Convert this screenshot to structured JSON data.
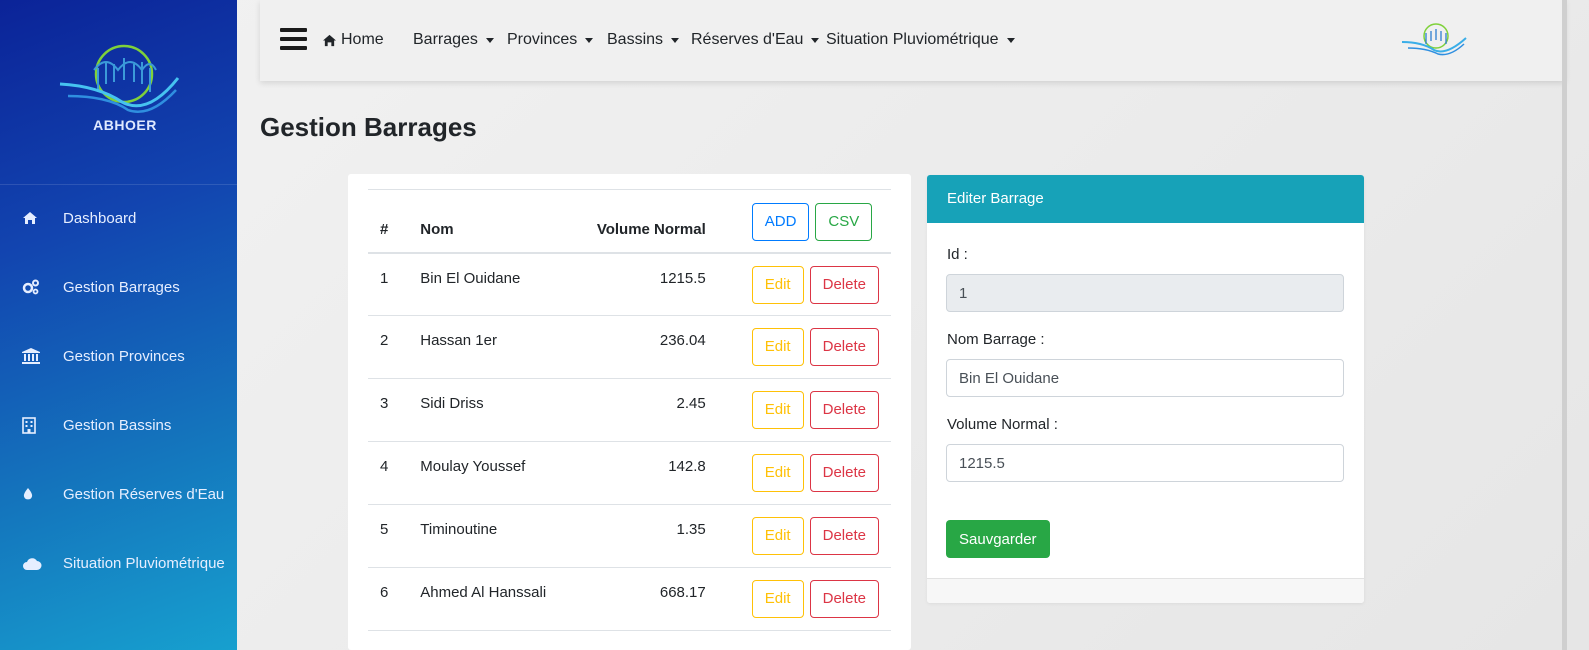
{
  "brand": {
    "name": "ABHOER"
  },
  "sidebar": {
    "items": [
      {
        "label": "Dashboard",
        "icon": "home-icon"
      },
      {
        "label": "Gestion Barrages",
        "icon": "gears-icon"
      },
      {
        "label": "Gestion Provinces",
        "icon": "bank-icon"
      },
      {
        "label": "Gestion Bassins",
        "icon": "building-icon"
      },
      {
        "label": "Gestion Réserves d'Eau",
        "icon": "water-drop-icon"
      },
      {
        "label": "Situation Pluviométrique",
        "icon": "cloud-icon"
      }
    ]
  },
  "navbar": {
    "home": "Home",
    "menus": [
      "Barrages",
      "Provinces",
      "Bassins",
      "Réserves d'Eau",
      "Situation Pluviométrique"
    ]
  },
  "page": {
    "title": "Gestion Barrages"
  },
  "table": {
    "headers": {
      "index": "#",
      "name": "Nom",
      "volume": "Volume Normal"
    },
    "add_label": "ADD",
    "csv_label": "CSV",
    "edit_label": "Edit",
    "delete_label": "Delete",
    "rows": [
      {
        "index": "1",
        "name": "Bin El Ouidane",
        "volume": "1215.5"
      },
      {
        "index": "2",
        "name": "Hassan 1er",
        "volume": "236.04"
      },
      {
        "index": "3",
        "name": "Sidi Driss",
        "volume": "2.45"
      },
      {
        "index": "4",
        "name": "Moulay Youssef",
        "volume": "142.8"
      },
      {
        "index": "5",
        "name": "Timinoutine",
        "volume": "1.35"
      },
      {
        "index": "6",
        "name": "Ahmed Al Hanssali",
        "volume": "668.17"
      }
    ]
  },
  "edit": {
    "header": "Editer Barrage",
    "id_label": "Id :",
    "id_value": "1",
    "name_label": "Nom Barrage :",
    "name_value": "Bin El Ouidane",
    "volume_label": "Volume Normal :",
    "volume_value": "1215.5",
    "save_label": "Sauvgarder"
  },
  "colors": {
    "sidebar_top": "#0b2398",
    "sidebar_bottom": "#17a0cf",
    "card_header": "#17a2b8",
    "save": "#28a745"
  }
}
